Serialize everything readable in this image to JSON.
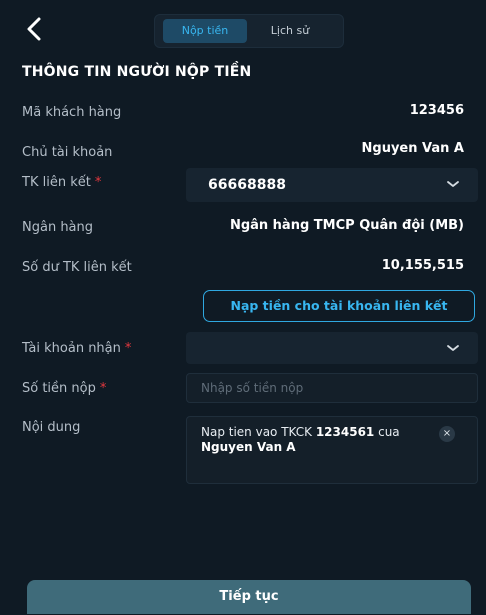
{
  "header": {
    "back_icon": "chevron-left-icon",
    "tabs": [
      {
        "label": "Nộp tiền",
        "active": true
      },
      {
        "label": "Lịch sử",
        "active": false
      }
    ]
  },
  "section_title": "THÔNG TIN NGƯỜI NỘP TIỀN",
  "fields": {
    "customer_code": {
      "label": "Mã khách hàng",
      "value": "123456"
    },
    "account_holder": {
      "label": "Chủ tài khoản",
      "value": "Nguyen Van A"
    },
    "linked_account": {
      "label": "TK liên kết",
      "required_mark": "*",
      "value": "66668888"
    },
    "bank": {
      "label": "Ngân hàng",
      "value": "Ngân hàng TMCP Quân đội (MB)"
    },
    "linked_balance": {
      "label": "Số dư TK liên kết",
      "value": "10,155,515"
    },
    "receiving_account": {
      "label": "Tài khoản nhận",
      "required_mark": "*",
      "value": ""
    },
    "amount": {
      "label": "Số tiền nộp",
      "required_mark": "*",
      "placeholder": "Nhập số tiền nộp",
      "value": ""
    },
    "content": {
      "label": "Nội dung",
      "text_prefix": "Nap tien vao TKCK ",
      "account_number": "1234561",
      "text_middle": " cua ",
      "name": "Nguyen Van A",
      "clear_label": "×"
    }
  },
  "link_button_label": "Nạp tiền cho tài khoản liên kết",
  "continue_button_label": "Tiếp tục",
  "colors": {
    "background": "#0f1a24",
    "accent": "#38b6f0",
    "required": "#e4383f",
    "continue_button": "#3f6b7a"
  }
}
